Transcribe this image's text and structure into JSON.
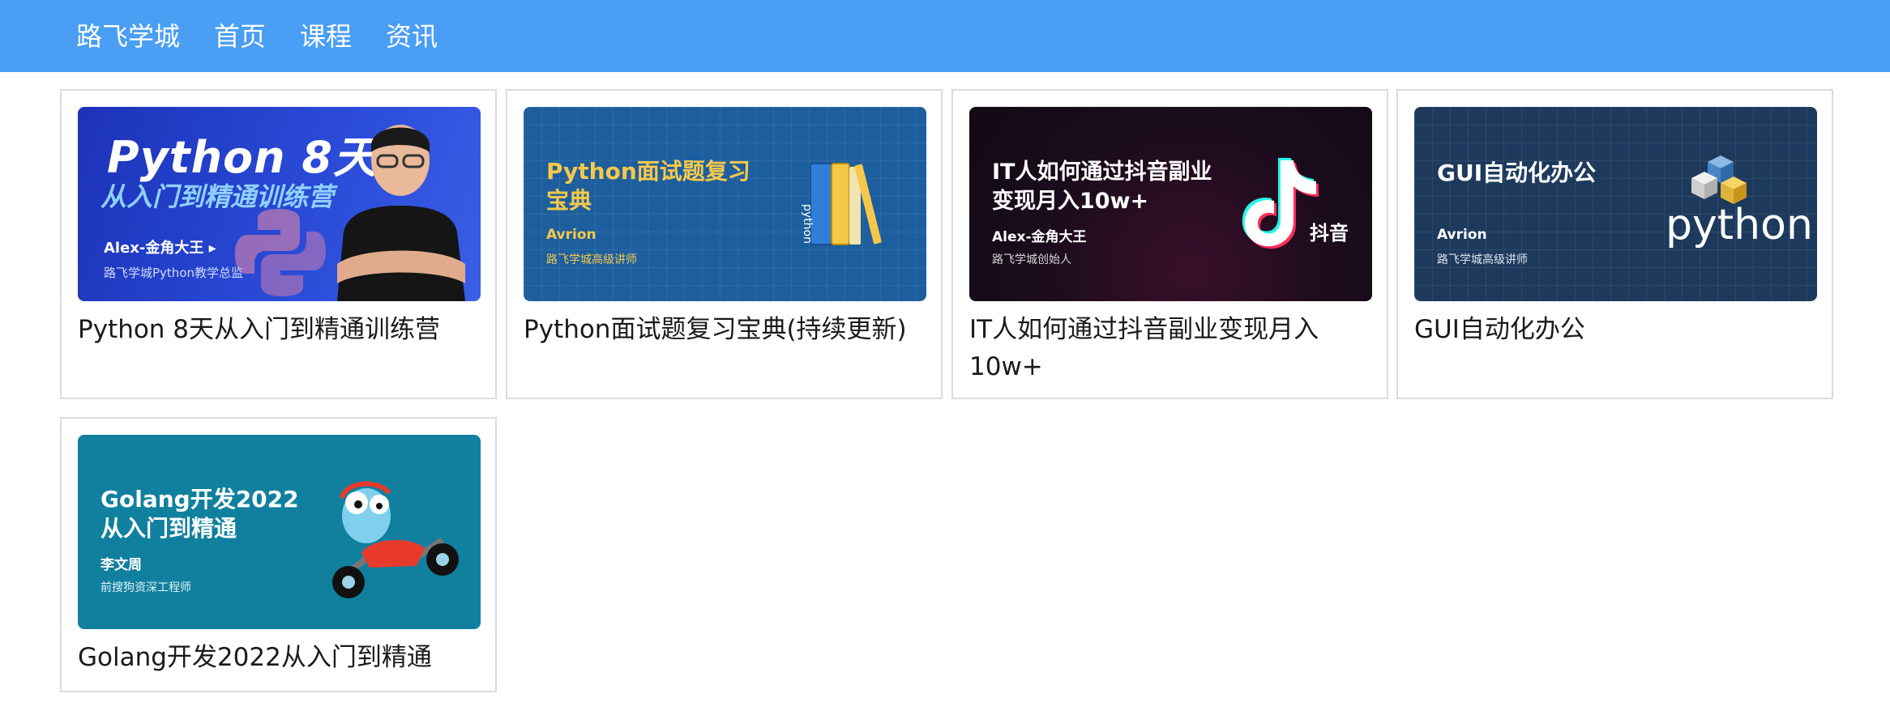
{
  "nav": {
    "brand": "路飞学城",
    "items": [
      "首页",
      "课程",
      "资讯"
    ]
  },
  "courses": [
    {
      "title": "Python 8天从入门到精通训练营",
      "cover": {
        "line1": "Python 8天",
        "line2": "从入门到精通训练营",
        "author": "Alex-金角大王 ▸",
        "role": "路飞学城Python教学总监"
      }
    },
    {
      "title": "Python面试题复习宝典(持续更新)",
      "cover": {
        "line1": "Python面试题复习",
        "line2": "宝典",
        "author": "Avrion",
        "role": "路飞学城高级讲师",
        "book_label": "python"
      }
    },
    {
      "title": "IT人如何通过抖音副业变现月入10w+",
      "cover": {
        "line1": "IT人如何通过抖音副业",
        "line2": "变现月入10w+",
        "author": "Alex-金角大王",
        "role": "路飞学城创始人",
        "logo_text": "抖音"
      }
    },
    {
      "title": "GUI自动化办公",
      "cover": {
        "line1": "GUI自动化办公",
        "author": "Avrion",
        "role": "路飞学城高级讲师",
        "logo_text": "python"
      }
    },
    {
      "title": "Golang开发2022从入门到精通",
      "cover": {
        "line1": "Golang开发2022",
        "line2": "从入门到精通",
        "author": "李文周",
        "role": "前搜狗资深工程师"
      }
    }
  ]
}
